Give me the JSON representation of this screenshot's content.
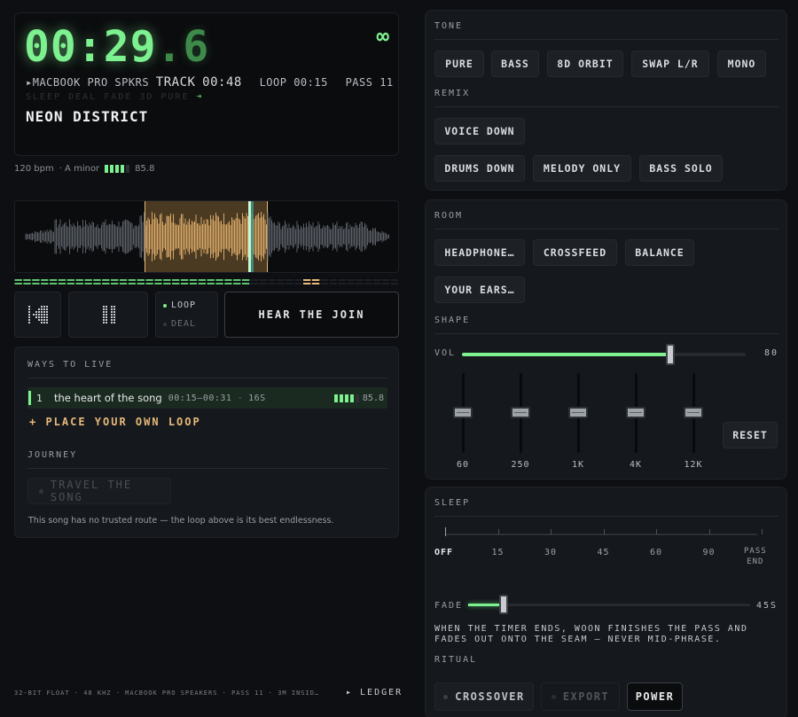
{
  "display": {
    "time_main": "00:29",
    "time_frac": ".6",
    "loop_symbol": "∞",
    "output_device": "▸MACBOOK PRO SPKRS",
    "track_label": "TRACK",
    "track_time": "00:48",
    "loop_label": "LOOP",
    "loop_time": "00:15",
    "pass_label": "PASS",
    "pass_count": "11",
    "ghost_modes": "SLEEP DEAL FADE 3D PURE",
    "ghost_arrow": "➜",
    "title": "NEON DISTRICT"
  },
  "meta": {
    "bpm": "120 bpm",
    "key": "· A minor",
    "score": "85.8",
    "score_fill": 0.8
  },
  "transport": {
    "loop_mode": "LOOP",
    "deal_mode": "DEAL",
    "hear_join": "HEAR THE JOIN"
  },
  "ways": {
    "title": "WAYS TO LIVE",
    "loops": [
      {
        "index": "1",
        "name": "the heart of the song",
        "range": "00:15–00:31",
        "sep": "·",
        "length": "16S",
        "score": "85.8"
      }
    ],
    "place_loop": "+ PLACE YOUR OWN LOOP",
    "journey_title": "JOURNEY",
    "travel_button": "TRAVEL THE SONG",
    "route_note": "This song has no trusted route — the loop above is its best endlessness."
  },
  "footer": {
    "status": "32-BIT FLOAT · 48 KHZ · MACBOOK PRO SPEAKERS · PASS 11 · 3M INSID…",
    "ledger": "▸ LEDGER"
  },
  "tone": {
    "title": "TONE",
    "presets": [
      "PURE",
      "BASS",
      "8D ORBIT",
      "SWAP L/R",
      "MONO"
    ]
  },
  "remix": {
    "title": "REMIX",
    "options": [
      "VOICE DOWN",
      "DRUMS DOWN",
      "MELODY ONLY",
      "BASS SOLO"
    ]
  },
  "room": {
    "title": "ROOM",
    "options": [
      "HEADPHONE…",
      "CROSSFEED",
      "BALANCE",
      "YOUR EARS…"
    ]
  },
  "shape": {
    "title": "SHAPE",
    "vol_label": "VOL",
    "vol_value": "80",
    "vol_fraction": 0.8,
    "eq_bands": [
      "60",
      "250",
      "1K",
      "4K",
      "12K"
    ],
    "reset": "RESET"
  },
  "sleep": {
    "title": "SLEEP",
    "stops": [
      "OFF",
      "15",
      "30",
      "45",
      "60",
      "90",
      "PASS\nEND"
    ],
    "fade_label": "FADE",
    "fade_value": "45S",
    "fade_fraction": 0.12,
    "note": "WHEN THE TIMER ENDS, WOON FINISHES THE PASS AND FADES OUT ONTO THE SEAM — NEVER MID-PHRASE."
  },
  "ritual": {
    "title": "RITUAL",
    "crossover": "CROSSOVER",
    "export": "EXPORT",
    "power": "POWER"
  },
  "colors": {
    "accent": "#7df08f",
    "loop_region": "#e7b97a",
    "background": "#0d0f12",
    "panel": "#15181c"
  }
}
